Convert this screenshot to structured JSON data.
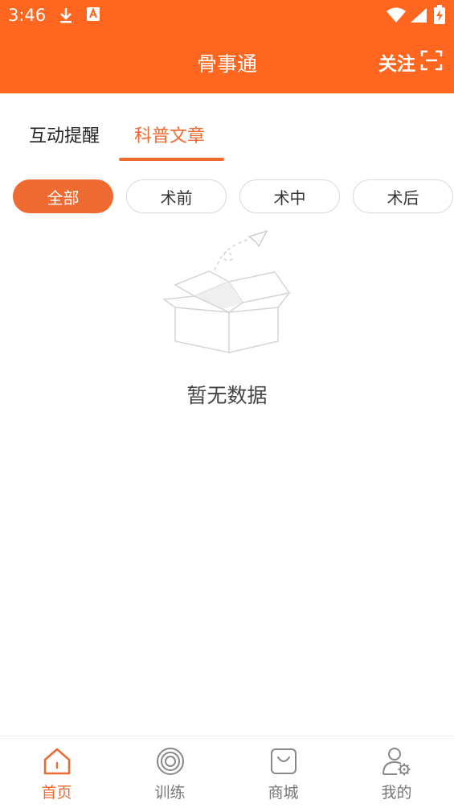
{
  "status_bar": {
    "time": "3:46"
  },
  "header": {
    "title": "骨事通",
    "follow_label": "关注"
  },
  "tabs": [
    {
      "label": "互动提醒",
      "active": false
    },
    {
      "label": "科普文章",
      "active": true
    }
  ],
  "filters": [
    {
      "label": "全部",
      "active": true
    },
    {
      "label": "术前",
      "active": false
    },
    {
      "label": "术中",
      "active": false
    },
    {
      "label": "术后",
      "active": false
    }
  ],
  "empty_state": {
    "text": "暂无数据"
  },
  "bottom_nav": [
    {
      "label": "首页",
      "icon": "home-icon",
      "active": true
    },
    {
      "label": "训练",
      "icon": "target-icon",
      "active": false
    },
    {
      "label": "商城",
      "icon": "shopping-bag-icon",
      "active": false
    },
    {
      "label": "我的",
      "icon": "user-settings-icon",
      "active": false
    }
  ],
  "colors": {
    "header_bg": "#ff6620",
    "accent": "#ef6a31",
    "inactive_text": "#777777"
  }
}
